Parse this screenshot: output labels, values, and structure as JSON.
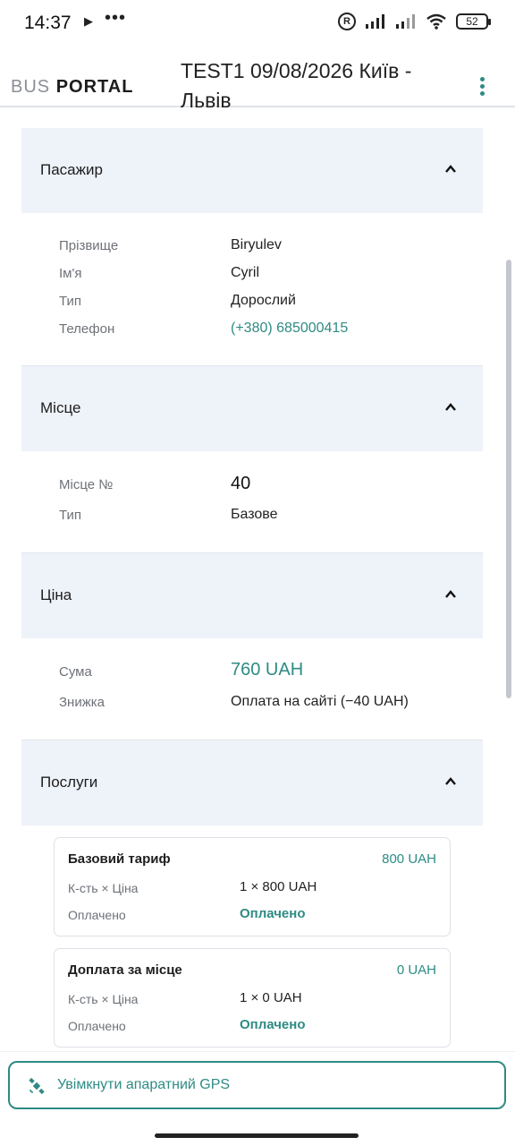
{
  "status_bar": {
    "time": "14:37",
    "battery": "52"
  },
  "header": {
    "logo_bus": "BUS",
    "logo_portal": "PORTAL",
    "title": "TEST1 09/08/2026 Київ - Львів"
  },
  "passenger": {
    "title": "Пасажир",
    "surname_label": "Прізвище",
    "surname": "Biryulev",
    "name_label": "Ім'я",
    "name": "Cyril",
    "type_label": "Тип",
    "type": "Дорослий",
    "phone_label": "Телефон",
    "phone": "(+380) 685000415"
  },
  "seat": {
    "title": "Місце",
    "number_label": "Місце №",
    "number": "40",
    "type_label": "Тип",
    "type": "Базове"
  },
  "price": {
    "title": "Ціна",
    "sum_label": "Сума",
    "sum": "760 UAH",
    "discount_label": "Знижка",
    "discount": "Оплата на сайті (−40 UAH)"
  },
  "services": {
    "title": "Послуги",
    "items": [
      {
        "name": "Базовий тариф",
        "price": "800 UAH",
        "qty_label": "К-сть × Ціна",
        "qty": "1 × 800 UAH",
        "paid_label": "Оплачено",
        "paid": "Оплачено"
      },
      {
        "name": "Доплата за місце",
        "price": "0 UAH",
        "qty_label": "К-сть × Ціна",
        "qty": "1 × 0 UAH",
        "paid_label": "Оплачено",
        "paid": "Оплачено"
      }
    ]
  },
  "gps": {
    "label": "Увімкнути апаратний GPS"
  },
  "colors": {
    "accent": "#2e8b84",
    "section_bg": "#eef2f9"
  }
}
